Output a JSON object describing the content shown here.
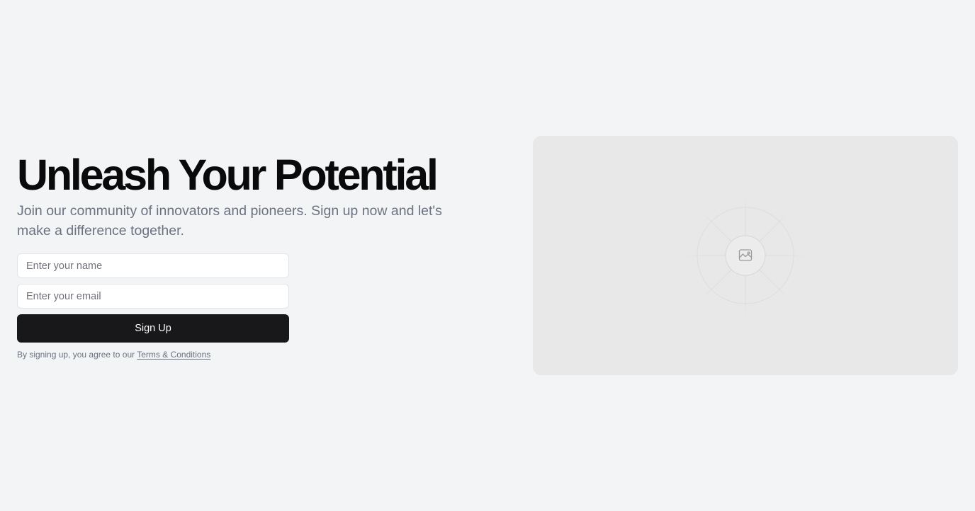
{
  "hero": {
    "title": "Unleash Your Potential",
    "subtitle": "Join our community of innovators and pioneers. Sign up now and let's make a difference together."
  },
  "form": {
    "name_placeholder": "Enter your name",
    "email_placeholder": "Enter your email",
    "submit_label": "Sign Up",
    "legal_prefix": "By signing up, you agree to our ",
    "legal_link": "Terms & Conditions"
  },
  "media": {
    "placeholder_icon": "image-icon"
  },
  "colors": {
    "background": "#f3f4f6",
    "primary_button": "#18181b",
    "muted_text": "#6b7280",
    "image_placeholder": "#e8e8e8"
  }
}
